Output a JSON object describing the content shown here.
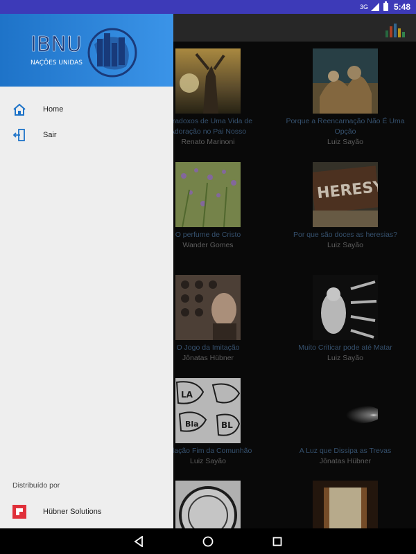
{
  "status_bar": {
    "network": "3G",
    "time": "5:48"
  },
  "drawer": {
    "logo_text": "IBNU",
    "logo_subtitle": "NAÇÕES UNIDAS",
    "menu": [
      {
        "label": "Home",
        "icon": "home-icon"
      },
      {
        "label": "Sair",
        "icon": "exit-icon"
      }
    ],
    "footer": {
      "distributed_by": "Distribuído por",
      "brand": "Hübner Solutions",
      "brand_icon": "hubner-logo-icon"
    }
  },
  "grid": {
    "items": [
      {
        "title_line1": "Paradoxos de Uma Vida de",
        "title_line2": "Adoração no Pai Nosso",
        "author": "Renato Marinoni"
      },
      {
        "title_line1": "Porque a Reencarnação Não É Uma",
        "title_line2": "Opção",
        "author": "Luiz Sayão"
      },
      {
        "title_line1": "O perfume de Cristo",
        "title_line2": "",
        "author": "Wander Gomes"
      },
      {
        "title_line1": "Por que são doces as heresias?",
        "title_line2": "",
        "author": "Luiz Sayão"
      },
      {
        "title_line1": "O Jogo da Imitação",
        "title_line2": "",
        "author": "Jônatas Hübner"
      },
      {
        "title_line1": "Muito Criticar pode até Matar",
        "title_line2": "",
        "author": "Luiz Sayão"
      },
      {
        "title_line1": "Falação Fim da Comunhão",
        "title_line2": "",
        "author": "Luiz Sayão"
      },
      {
        "title_line1": "A Luz que Dissipa as Trevas",
        "title_line2": "",
        "author": "Jônatas Hübner"
      }
    ]
  },
  "colors": {
    "status_bar": "#3d3ab8",
    "drawer_header": "#2b84dc",
    "accent": "#1e73c8",
    "brand_red": "#e0303a"
  },
  "nav_bar": {
    "back_icon": "back-triangle-icon",
    "home_icon": "home-circle-icon",
    "recents_icon": "recents-square-icon"
  }
}
